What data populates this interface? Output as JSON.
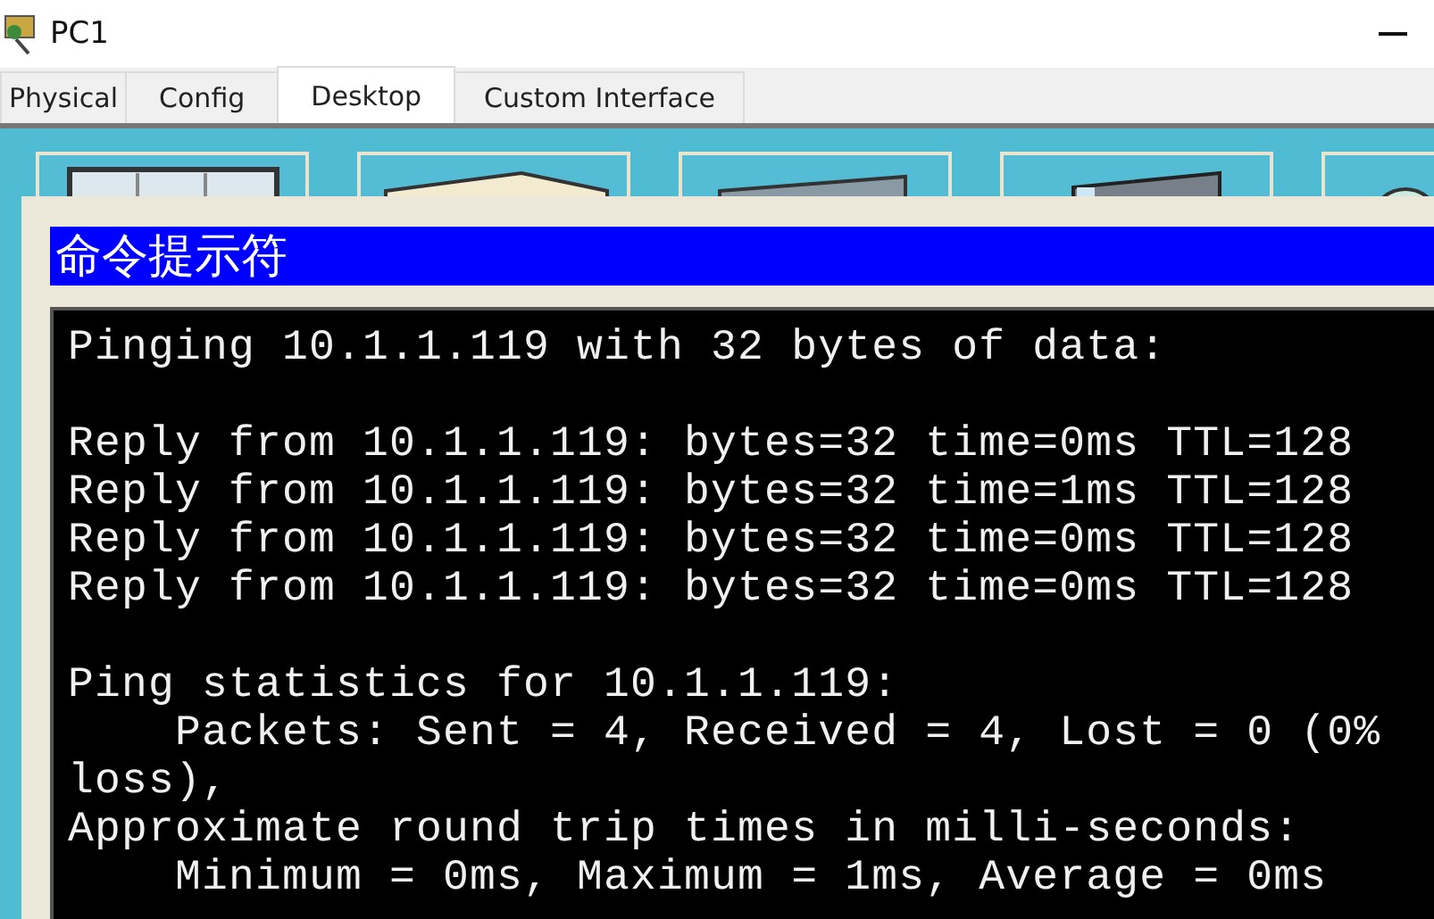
{
  "window": {
    "title": "PC1"
  },
  "tabs": [
    {
      "label": "Physical",
      "selected": false
    },
    {
      "label": "Config",
      "selected": false
    },
    {
      "label": "Desktop",
      "selected": true
    },
    {
      "label": "Custom Interface",
      "selected": false
    }
  ],
  "command_prompt": {
    "title": "命令提示符",
    "blocks": [
      {
        "lines": [
          "Pinging 10.1.1.119 with 32 bytes of data:"
        ]
      },
      {
        "lines": [
          "Reply from 10.1.1.119: bytes=32 time=0ms TTL=128",
          "Reply from 10.1.1.119: bytes=32 time=1ms TTL=128",
          "Reply from 10.1.1.119: bytes=32 time=0ms TTL=128",
          "Reply from 10.1.1.119: bytes=32 time=0ms TTL=128"
        ]
      },
      {
        "lines": [
          "Ping statistics for 10.1.1.119:",
          "    Packets: Sent = 4, Received = 4, Lost = 0 (0%",
          "loss),",
          "Approximate round trip times in milli-seconds:",
          "    Minimum = 0ms, Maximum = 1ms, Average = 0ms"
        ]
      }
    ]
  }
}
